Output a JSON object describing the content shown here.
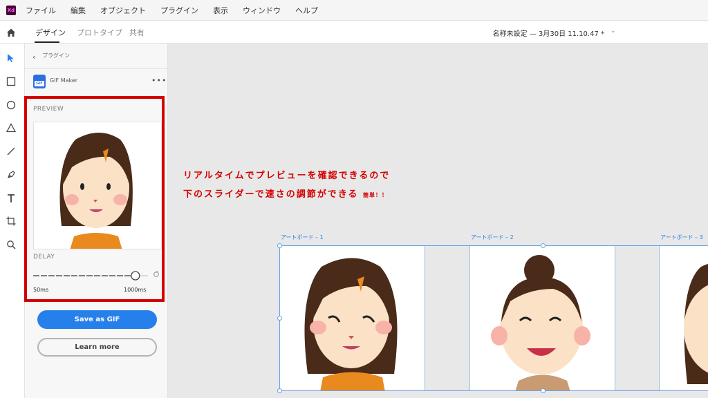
{
  "app": {
    "logo": "Xd"
  },
  "menu": [
    "ファイル",
    "編集",
    "オブジェクト",
    "プラグイン",
    "表示",
    "ウィンドウ",
    "ヘルプ"
  ],
  "tabs": [
    "デザイン",
    "プロトタイプ",
    "共有"
  ],
  "active_tab": "デザイン",
  "document_title": "名称未設定 — 3月30日 11.10.47 *",
  "tools": [
    "select-arrow-icon",
    "rectangle-icon",
    "ellipse-icon",
    "polygon-icon",
    "line-icon",
    "pen-icon",
    "text-icon",
    "artboard-icon",
    "zoom-icon"
  ],
  "plugin": {
    "breadcrumb": "プラグイン",
    "icon_text": "GIF",
    "name": "GIF Maker",
    "more": "•••",
    "preview_label": "PREVIEW",
    "delay_label": "DELAY",
    "slider_min": "50ms",
    "slider_max": "1000ms",
    "slider_value_fraction": 0.9,
    "save_label": "Save as GIF",
    "learn_label": "Learn more"
  },
  "annotation": {
    "line1": "リアルタイムでプレビューを確認できるので",
    "line2": "下のスライダーで速さの調節ができる",
    "line2_small": "簡単！！"
  },
  "artboards": [
    {
      "label": "アートボード – 1"
    },
    {
      "label": "アートボード – 2"
    },
    {
      "label": "アートボード – 3"
    }
  ],
  "colors": {
    "accent": "#2680eb",
    "highlight": "#d40000"
  }
}
